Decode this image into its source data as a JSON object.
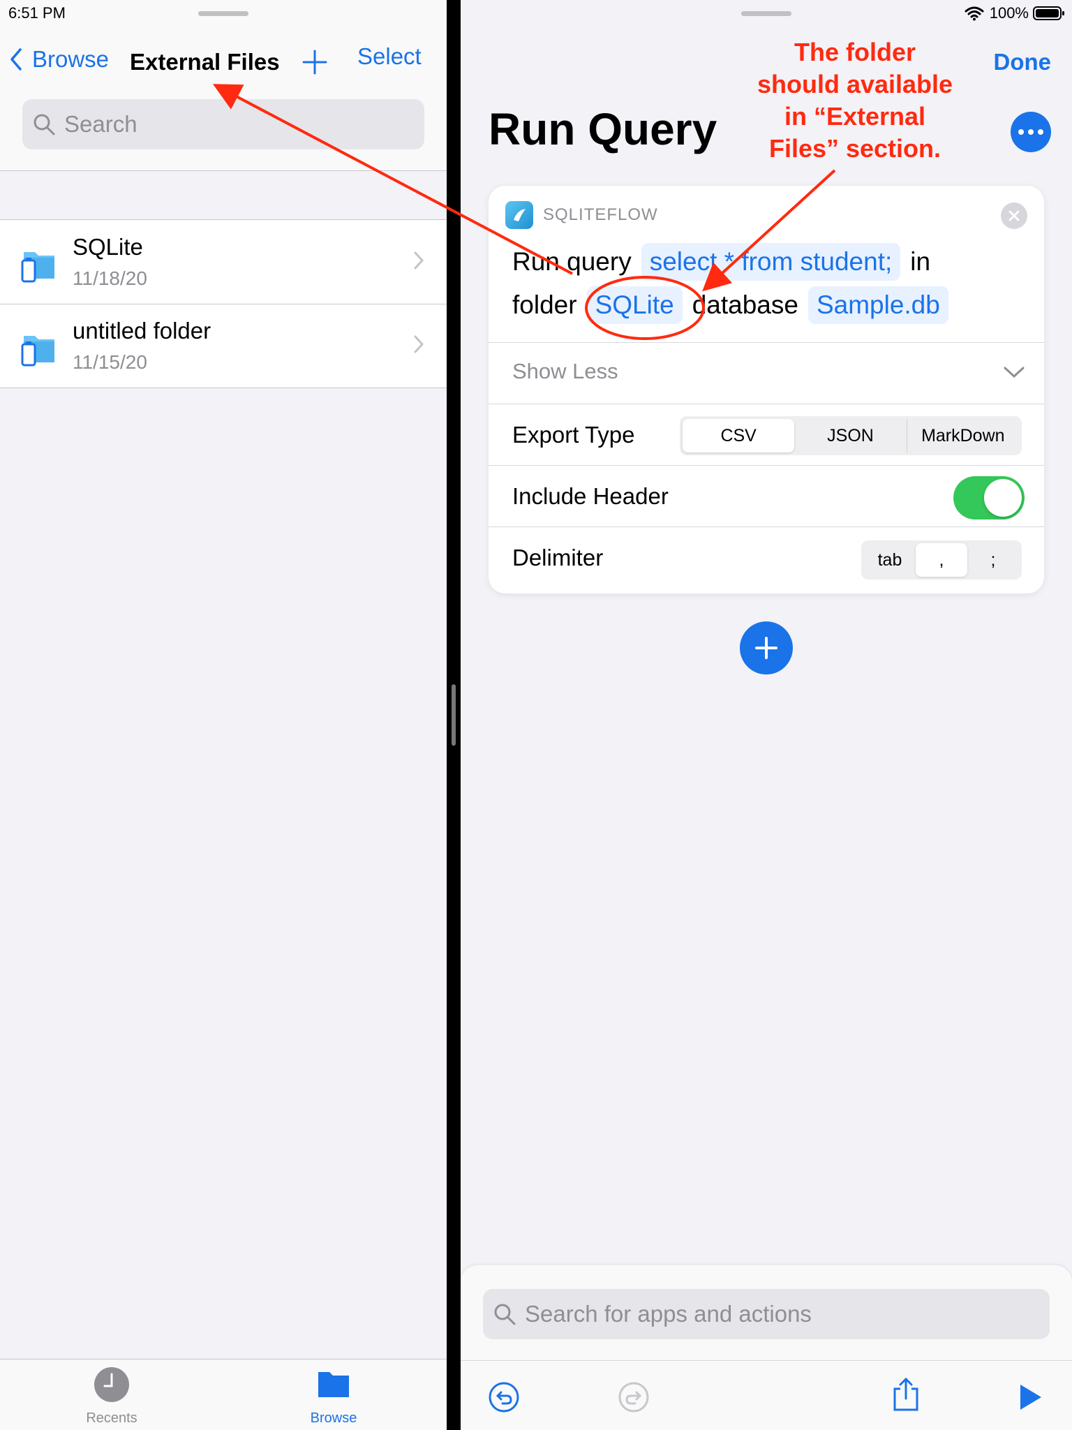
{
  "status": {
    "time": "6:51 PM",
    "battery": "100%"
  },
  "left": {
    "nav": {
      "back_label": "Browse",
      "title": "External Files",
      "select_label": "Select"
    },
    "search": {
      "placeholder": "Search"
    },
    "items": [
      {
        "name": "SQLite",
        "date": "11/18/20"
      },
      {
        "name": "untitled folder",
        "date": "11/15/20"
      }
    ],
    "tabs": [
      {
        "label": "Recents"
      },
      {
        "label": "Browse"
      }
    ]
  },
  "right": {
    "done_label": "Done",
    "title": "Run Query",
    "card": {
      "app_name": "SQLITEFLOW",
      "run_query": "Run query",
      "query": "select * from student;",
      "in": "in",
      "folder_label": "folder",
      "folder": "SQLite",
      "database_label": "database",
      "database": "Sample.db",
      "show_less": "Show Less",
      "export_type_label": "Export Type",
      "export_options": [
        "CSV",
        "JSON",
        "MarkDown"
      ],
      "export_selected": "CSV",
      "include_header_label": "Include Header",
      "include_header": true,
      "delimiter_label": "Delimiter",
      "delimiter_options": [
        "tab",
        ",",
        ";"
      ],
      "delimiter_selected": ","
    },
    "bottom_search_placeholder": "Search for apps and actions"
  },
  "annotation": {
    "lines": [
      "The folder",
      "should available",
      "in “External",
      "Files” section."
    ]
  },
  "colors": {
    "accent": "#1a73e8",
    "annotation": "#ff2a0f",
    "toggle_on": "#34c759"
  }
}
